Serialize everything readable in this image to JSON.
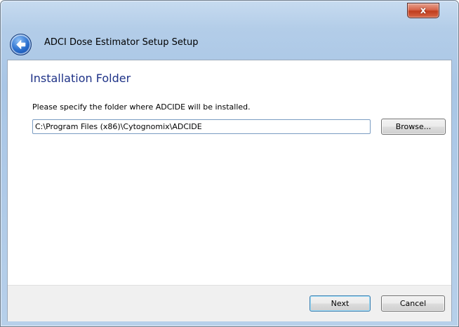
{
  "window": {
    "title": "ADCI Dose Estimator Setup Setup",
    "close_label": "x"
  },
  "page": {
    "heading": "Installation Folder",
    "instruction": "Please specify the folder where ADCIDE will be installed.",
    "folder_path": "C:\\Program Files (x86)\\Cytognomix\\ADCIDE"
  },
  "buttons": {
    "browse": "Browse...",
    "next": "Next",
    "cancel": "Cancel"
  },
  "icons": {
    "back": "back-arrow-icon",
    "close": "close-icon"
  }
}
